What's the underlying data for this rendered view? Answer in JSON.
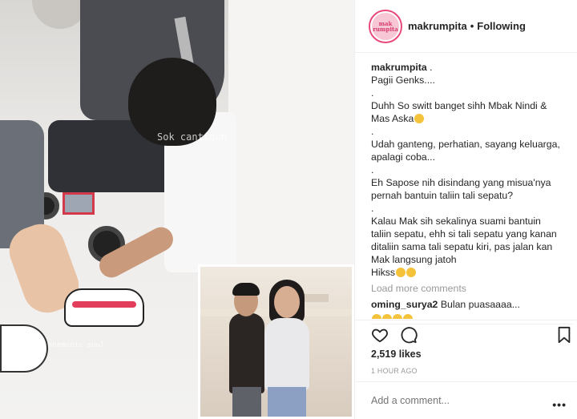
{
  "media": {
    "watermark_main": "Sok cantiqun",
    "watermark_small": "mnemonic soul"
  },
  "post": {
    "username": "makrumpita",
    "separator": "•",
    "follow_status": "Following",
    "avatar_text": "mak rumpita"
  },
  "caption": {
    "author": "makrumpita",
    "author_suffix": ".",
    "lines": [
      "Pagii Genks....",
      ".",
      "Duhh So switt banget sihh Mbak Nindi &",
      "Mas Aska",
      ".",
      "Udah ganteng, perhatian, sayang keluarga,",
      "apalagi coba...",
      ".",
      "Eh Sapose nih disindang yang misua'nya",
      "pernah bantuin taliin tali sepatu?",
      ".",
      "Kalau Mak sih sekalinya suami bantuin",
      "taliin sepatu, ehh si tali sepatu yang kanan",
      "ditaliin sama tali sepatu kiri, pas jalan kan",
      "Mak langsung jatoh",
      "Hikss"
    ]
  },
  "load_more": "Load more comments",
  "comments": [
    {
      "author": "oming_surya2",
      "text": "Bulan puasaaaa..."
    }
  ],
  "stats": {
    "likes": "2,519 likes",
    "time": "1 HOUR AGO"
  },
  "add_comment": {
    "placeholder": "Add a comment...",
    "more": "•••"
  },
  "icons": {
    "like": "heart-icon",
    "comment": "comment-icon",
    "save": "bookmark-icon",
    "more": "more-options-icon"
  },
  "colors": {
    "text": "#262626",
    "muted": "#999999",
    "border": "#efefef",
    "avatar_ring": "#e8497a"
  }
}
